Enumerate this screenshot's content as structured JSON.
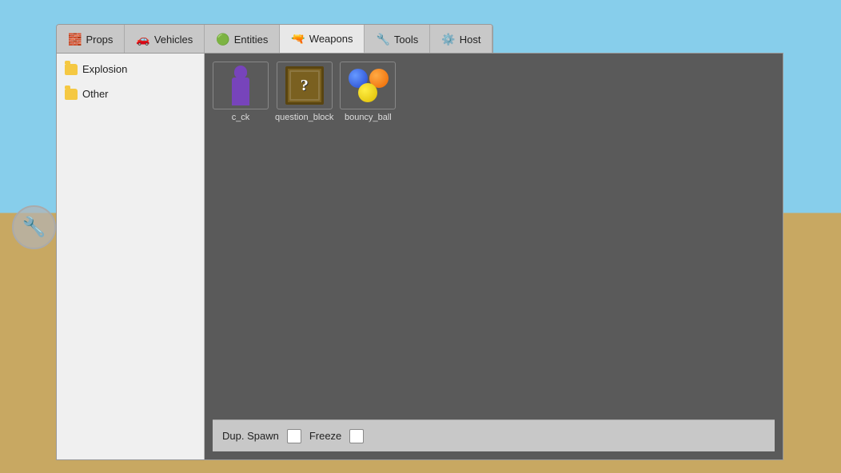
{
  "background": {
    "sky_color": "#87CEEB",
    "ground_color": "#c8a862"
  },
  "tabs": [
    {
      "id": "props",
      "label": "Props",
      "icon": "🧱",
      "active": false
    },
    {
      "id": "vehicles",
      "label": "Vehicles",
      "icon": "🚗",
      "active": false
    },
    {
      "id": "entities",
      "label": "Entities",
      "icon": "🟢",
      "active": false
    },
    {
      "id": "weapons",
      "label": "Weapons",
      "icon": "🔫",
      "active": true
    },
    {
      "id": "tools",
      "label": "Tools",
      "icon": "🔧",
      "active": false
    },
    {
      "id": "host",
      "label": "Host",
      "icon": "⚙️",
      "active": false
    }
  ],
  "sidebar": {
    "items": [
      {
        "id": "explosion",
        "label": "Explosion"
      },
      {
        "id": "other",
        "label": "Other"
      }
    ]
  },
  "items": [
    {
      "id": "c_ck",
      "label": "c_ck",
      "type": "figure"
    },
    {
      "id": "question_block",
      "label": "question_block",
      "type": "qblock"
    },
    {
      "id": "bouncy_ball",
      "label": "bouncy_ball",
      "type": "balls"
    }
  ],
  "bottom_bar": {
    "dup_spawn_label": "Dup. Spawn",
    "freeze_label": "Freeze",
    "dup_spawn_checked": false,
    "freeze_checked": false
  }
}
